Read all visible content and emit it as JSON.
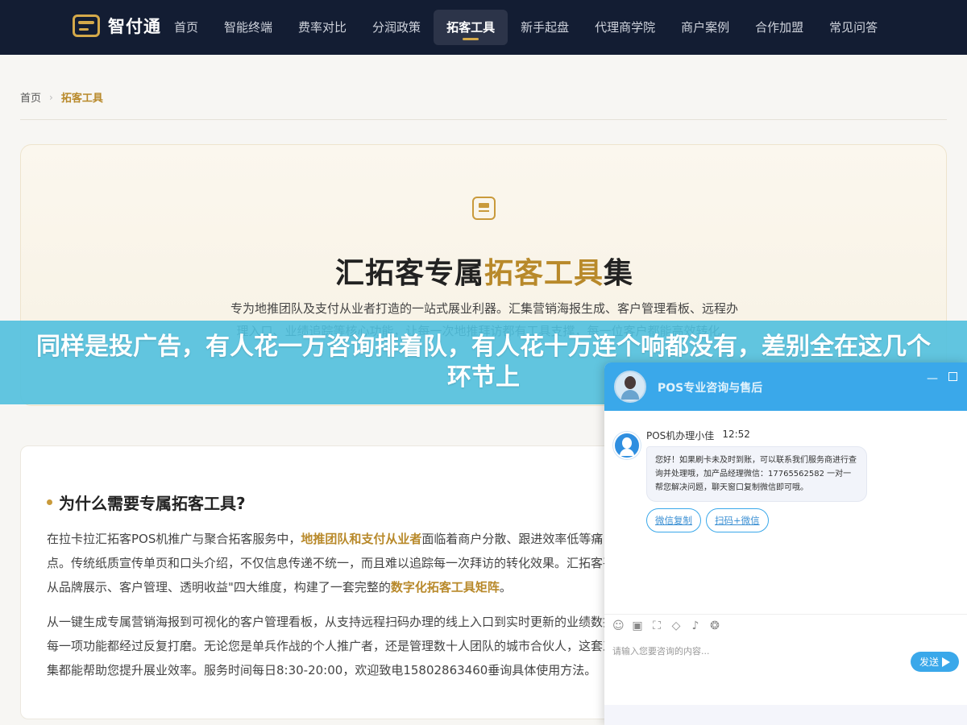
{
  "nav": {
    "logo": "智付通",
    "items": [
      "首页",
      "智能终端",
      "费率对比",
      "分润政策",
      "拓客工具",
      "新手起盘",
      "代理商学院",
      "商户案例",
      "合作加盟",
      "常见问答"
    ],
    "active_index": 4
  },
  "breadcrumb": {
    "home": "首页",
    "sep": "›",
    "current": "拓客工具"
  },
  "hero": {
    "title_a": "汇拓客专属",
    "title_b": "拓客工具",
    "title_c": "集",
    "desc": "专为地推团队及支付从业者打造的一站式展业利器。汇集营销海报生成、客户管理看板、远程办理入口、业绩追踪等核心功能，让每一次地推拜访都有工具支撑，每一位客户都能高效转化。"
  },
  "banner": {
    "text": "同样是投广告，有人花一万咨询排着队，有人花十万连个响都没有，差别全在这几个环节上"
  },
  "article": {
    "heading": "为什么需要专属拓客工具?",
    "p1_a": "在拉卡拉汇拓客POS机推广与聚合拓客服务中，",
    "p1_hl1": "地推团队和支付从业者",
    "p1_b": "面临着商户分散、跟进效率低等痛点。传统纸质宣传单页和口头介绍，不仅信息传递不统一，而且难以追踪每一次拜访的转化效果。汇拓客平台从品牌展示、客户管理、透明收益\"四大维度，构建了一套完整的",
    "p1_hl2": "数字化拓客工具矩阵",
    "p1_c": "。",
    "p2": "从一键生成专属营销海报到可视化的客户管理看板，从支持远程扫码办理的线上入口到实时更新的业绩数据，每一项功能都经过反复打磨。无论您是单兵作战的个人推广者，还是管理数十人团队的城市合伙人，这套工具集都能帮助您提升展业效率。服务时间每日8:30-20:00，欢迎致电15802863460垂询具体使用方法。"
  },
  "chat": {
    "title": "POS专业咨询与售后",
    "min": "—",
    "agent": "POS机办理小佳",
    "time": "12:52",
    "message": "您好！如果刷卡未及时到账，可以联系我们服务商进行查询并处理哦，加产品经理微信：17765562582 一对一帮您解决问题，聊天窗口复制微信即可哦。",
    "btn1": "微信复制",
    "btn2": "扫码+微信",
    "tools": [
      "☺",
      "▣",
      "⛶",
      "◇",
      "♪",
      "❂"
    ],
    "placeholder": "请输入您要咨询的内容...",
    "send": "发送"
  }
}
